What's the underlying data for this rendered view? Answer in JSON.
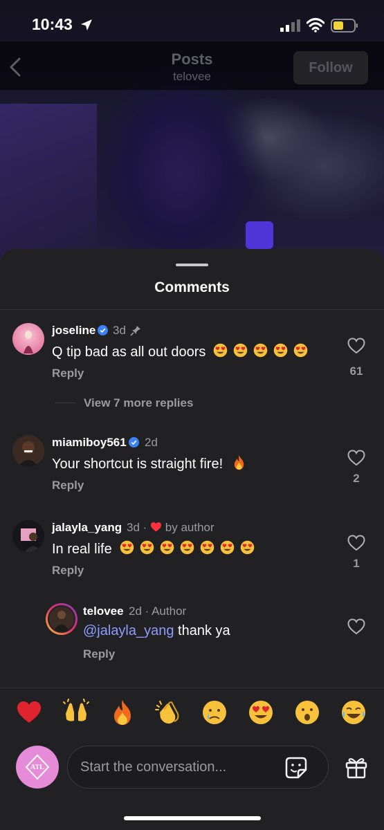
{
  "status_bar": {
    "time": "10:43"
  },
  "header": {
    "title": "Posts",
    "subtitle": "telovee",
    "follow_label": "Follow"
  },
  "sheet": {
    "title": "Comments"
  },
  "comments": [
    {
      "username": "joseline",
      "time": "3d",
      "text": "Q tip bad as all out doors",
      "emoji_count": 5,
      "reply_label": "Reply",
      "likes": "61",
      "pinned": true,
      "verified": true
    },
    {
      "username": "miamiboy561",
      "time": "2d",
      "text": "Your shortcut is straight fire!",
      "reply_label": "Reply",
      "likes": "2",
      "verified": true
    },
    {
      "username": "jalayla_yang",
      "time": "3d",
      "by_author": "by author",
      "text": "In real life",
      "emoji_count": 7,
      "reply_label": "Reply",
      "likes": "1"
    },
    {
      "username": "telovee",
      "time": "2d",
      "author_badge": "Author",
      "mention": "@jalayla_yang",
      "text": " thank ya",
      "reply_label": "Reply",
      "likes": ""
    }
  ],
  "view_more": {
    "label": "View 7 more replies"
  },
  "reactions": [
    "heart",
    "raised-hands",
    "fire",
    "clapping-hands",
    "crying-face",
    "heart-eyes",
    "surprised-face",
    "laughing-face"
  ],
  "composer": {
    "placeholder": "Start the conversation..."
  },
  "colors": {
    "accent": "#e58bd8",
    "mention": "#8e9cff",
    "verified": "#3b82f6",
    "sheet_bg": "#212124"
  }
}
